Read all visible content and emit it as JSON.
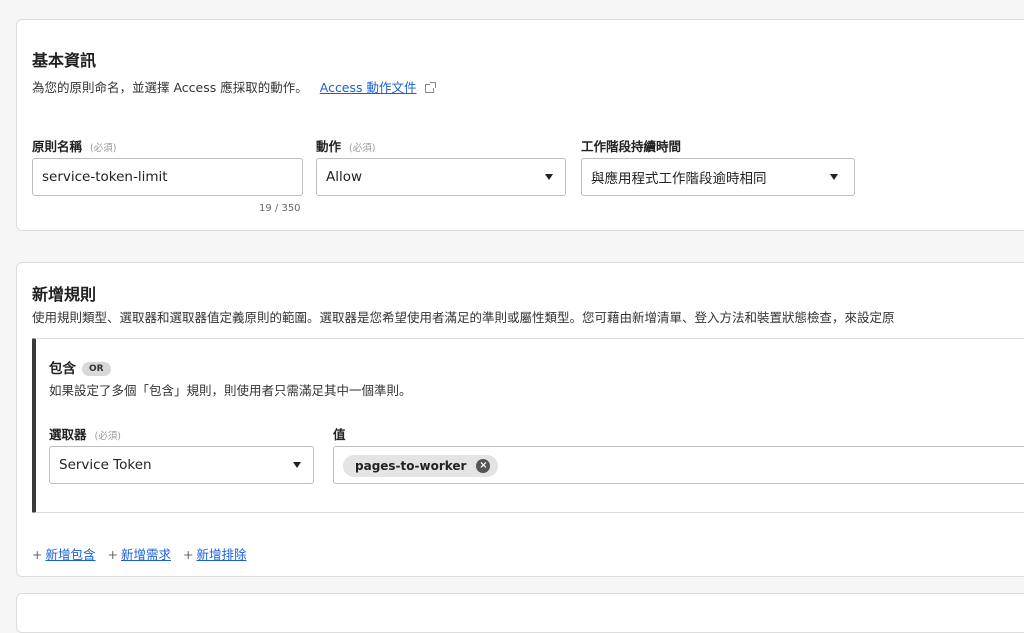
{
  "basic": {
    "title": "基本資訊",
    "desc": "為您的原則命名，並選擇 Access 應採取的動作。",
    "doc_link": "Access 動作文件",
    "name_label": "原則名稱",
    "required": "(必須)",
    "name_value": "service-token-limit",
    "name_counter": "19 / 350",
    "action_label": "動作",
    "action_value": "Allow",
    "session_label": "工作階段持續時間",
    "session_value": "與應用程式工作階段逾時相同"
  },
  "rules": {
    "title": "新增規則",
    "desc": "使用規則類型、選取器和選取器值定義原則的範圍。選取器是您希望使用者滿足的準則或屬性類型。您可藉由新增清單、登入方法和裝置狀態檢查，來設定原",
    "include_title": "包含",
    "or_badge": "OR",
    "include_desc": "如果設定了多個「包含」規則，則使用者只需滿足其中一個準則。",
    "selector_label": "選取器",
    "required": "(必須)",
    "selector_value": "Service Token",
    "value_label": "值",
    "chip_value": "pages-to-worker",
    "add_include": "新增包含",
    "add_require": "新增需求",
    "add_exclude": "新增排除",
    "plus": "+"
  }
}
